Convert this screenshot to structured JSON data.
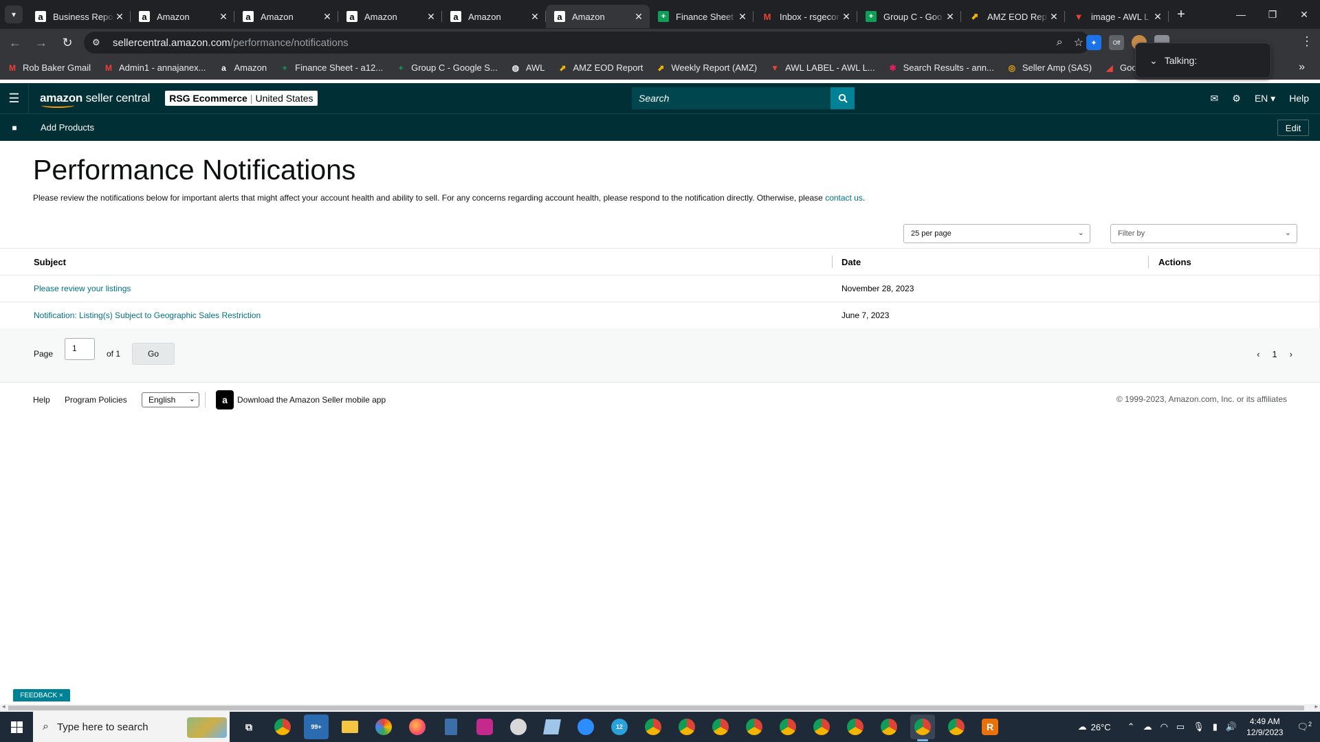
{
  "browser": {
    "tabs": [
      {
        "title": "Business Repor",
        "favicon": "amazon-icon",
        "active": false
      },
      {
        "title": "Amazon",
        "favicon": "amazon-icon",
        "active": false
      },
      {
        "title": "Amazon",
        "favicon": "amazon-icon",
        "active": false
      },
      {
        "title": "Amazon",
        "favicon": "amazon-icon",
        "active": false
      },
      {
        "title": "Amazon",
        "favicon": "amazon-icon",
        "active": false
      },
      {
        "title": "Amazon",
        "favicon": "amazon-icon",
        "active": true
      },
      {
        "title": "Finance Sheet",
        "favicon": "sheets-icon",
        "active": false
      },
      {
        "title": "Inbox - rsgecor",
        "favicon": "gmail-icon",
        "active": false
      },
      {
        "title": "Group C - Goo",
        "favicon": "sheets-icon",
        "active": false
      },
      {
        "title": "AMZ EOD Rep",
        "favicon": "report-icon",
        "active": false
      },
      {
        "title": "image - AWL L",
        "favicon": "awl-icon",
        "active": false
      }
    ],
    "url_domain": "sellercentral.amazon.com",
    "url_path": "/performance/notifications",
    "ext_badge": "Off",
    "bookmarks": [
      {
        "label": "Rob Baker Gmail",
        "icon": "gmail-icon"
      },
      {
        "label": "Admin1 - annajanex...",
        "icon": "gmail-icon"
      },
      {
        "label": "Amazon",
        "icon": "amazon-icon"
      },
      {
        "label": "Finance Sheet - a12...",
        "icon": "sheets-icon"
      },
      {
        "label": "Group C - Google S...",
        "icon": "sheets-icon"
      },
      {
        "label": "AWL",
        "icon": "globe-icon"
      },
      {
        "label": "AMZ EOD Report",
        "icon": "report-icon"
      },
      {
        "label": "Weekly Report (AMZ)",
        "icon": "report-icon"
      },
      {
        "label": "AWL LABEL - AWL L...",
        "icon": "awl-icon"
      },
      {
        "label": "Search Results - ann...",
        "icon": "slack-icon"
      },
      {
        "label": "Seller Amp (SAS)",
        "icon": "selleramp-icon"
      },
      {
        "label": "Google Chrome Ext...",
        "icon": "extension-icon"
      }
    ],
    "talking_label": "Talking:"
  },
  "header": {
    "logo_bold": "amazon",
    "logo_light": " seller central",
    "account_name": "RSG Ecommerce",
    "account_region": "United States",
    "search_placeholder": "Search",
    "lang": "EN",
    "help": "Help",
    "sub_link": "Add Products",
    "edit": "Edit"
  },
  "main": {
    "title": "Performance Notifications",
    "description": "Please review the notifications below for important alerts that might affect your account health and ability to sell. For any concerns regarding account health, please respond to the notification directly. Otherwise, please ",
    "contact_link": "contact us",
    "description_end": ".",
    "per_page": "25 per page",
    "filter_placeholder": "Filter by",
    "columns": {
      "subject": "Subject",
      "date": "Date",
      "actions": "Actions"
    },
    "rows": [
      {
        "subject": "Please review your listings",
        "date": "November 28, 2023"
      },
      {
        "subject": "Notification: Listing(s) Subject to Geographic Sales Restriction",
        "date": "June 7, 2023"
      }
    ],
    "pager": {
      "page_label": "Page",
      "page_value": "1",
      "of_label": "of 1",
      "go": "Go",
      "current": "1"
    }
  },
  "footer": {
    "help": "Help",
    "policies": "Program Policies",
    "language": "English",
    "app_download": "Download the Amazon Seller mobile app",
    "copyright": "© 1999-2023, Amazon.com, Inc. or its affiliates",
    "feedback": "FEEDBACK"
  },
  "taskbar": {
    "search_placeholder": "Type here to search",
    "mail_badge": "99+",
    "telegram_badge": "12",
    "weather": "26°C",
    "time": "4:49 AM",
    "date": "12/9/2023",
    "notification_count": "2"
  },
  "colors": {
    "header_bg": "#002f36",
    "link": "#007185",
    "accent": "#008296",
    "logo_smile": "#ff9900"
  }
}
